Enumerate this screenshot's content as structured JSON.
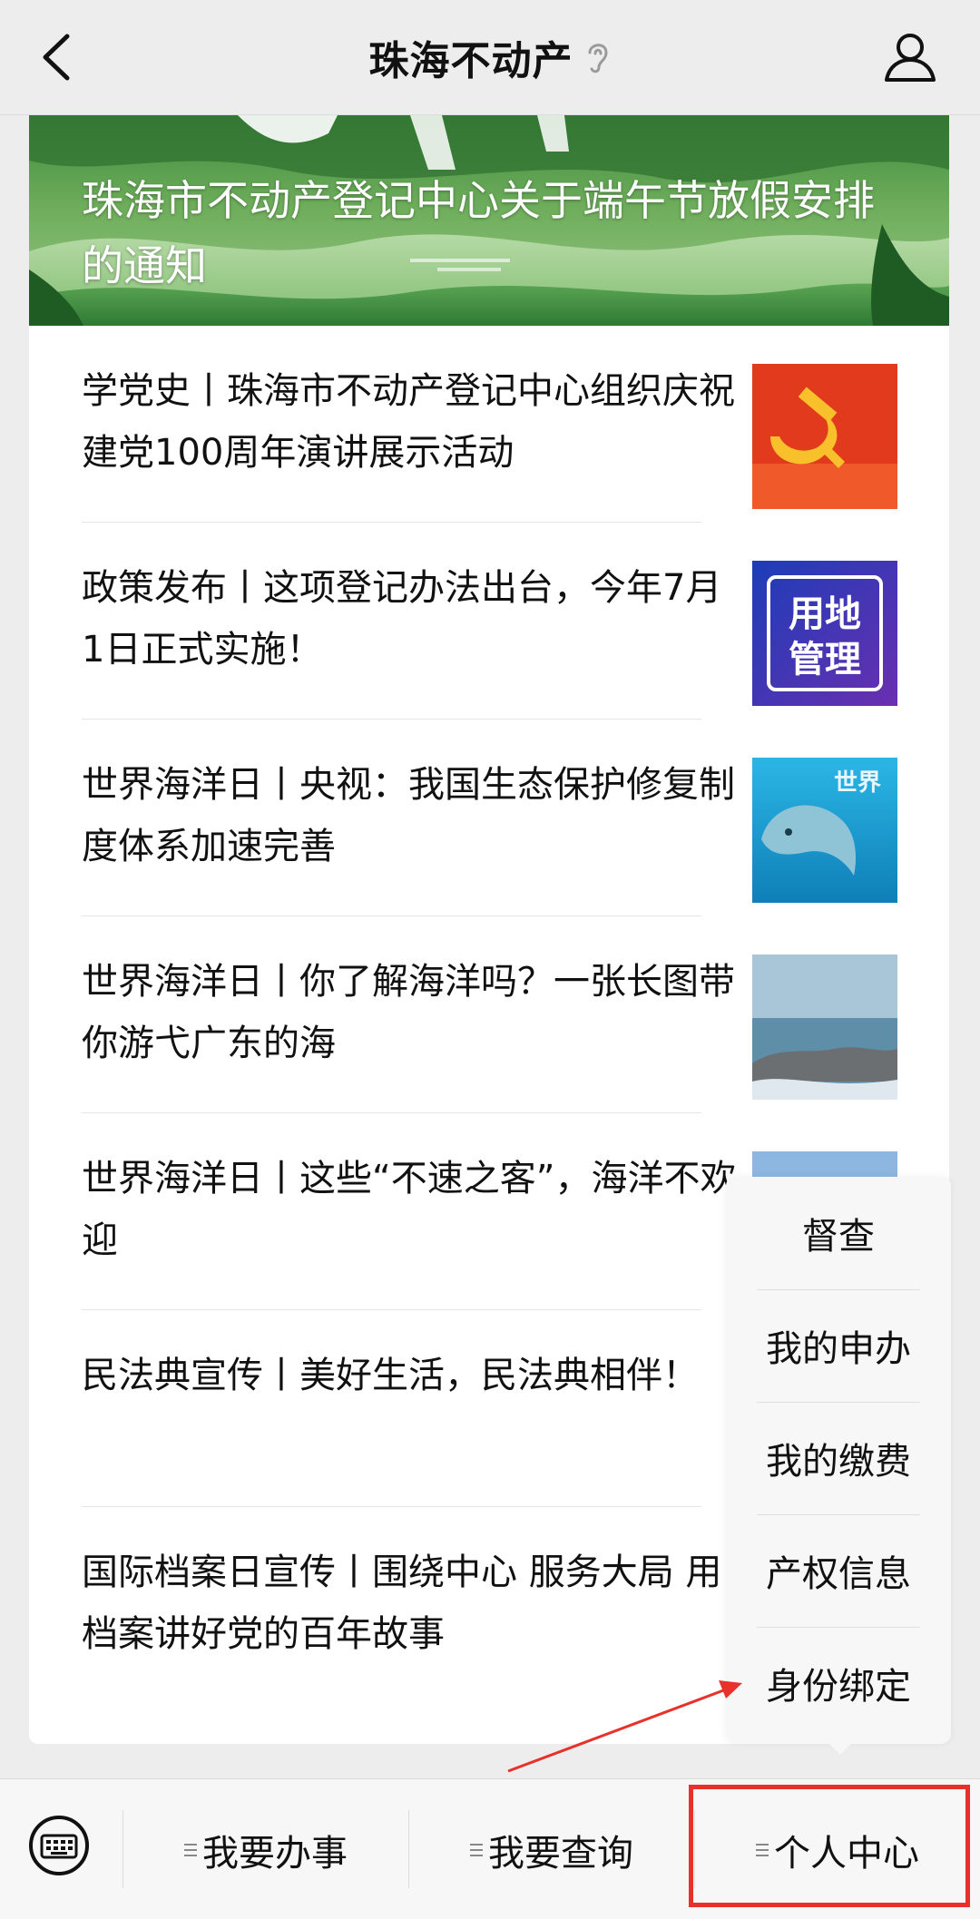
{
  "header": {
    "title": "珠海不动产",
    "back_icon": "back-arrow-icon",
    "ear_icon": "ear-icon",
    "profile_icon": "user-profile-icon"
  },
  "banner": {
    "title": "珠海市不动产登记中心关于端午节放假安排的通知"
  },
  "articles": [
    {
      "title": "学党史丨珠海市不动产登记中心组织庆祝建党100周年演讲展示活动",
      "thumb": "party-emblem-thumb"
    },
    {
      "title": "政策发布丨这项登记办法出台，今年7月1日正式实施！",
      "thumb": "land-management-thumb",
      "thumb_text_1": "用地",
      "thumb_text_2": "管理"
    },
    {
      "title": "世界海洋日丨央视：我国生态保护修复制度体系加速完善",
      "thumb": "dolphin-thumb",
      "thumb_text": "世界"
    },
    {
      "title": "世界海洋日丨你了解海洋吗？一张长图带你游弋广东的海",
      "thumb": "coast-thumb"
    },
    {
      "title": "世界海洋日丨这些“不速之客”，海洋不欢迎",
      "thumb": "ocean-thumb"
    },
    {
      "title": "民法典宣传丨美好生活，民法典相伴！"
    },
    {
      "title": "国际档案日宣传丨围绕中心  服务大局  用档案讲好党的百年故事"
    }
  ],
  "popup_menu": {
    "items": [
      "督查",
      "我的申办",
      "我的缴费",
      "产权信息",
      "身份绑定"
    ]
  },
  "bottom_menu": {
    "keyboard_icon": "keyboard-icon",
    "items": [
      "我要办事",
      "我要查询",
      "个人中心"
    ]
  },
  "colors": {
    "background": "#ededed",
    "annotation_red": "#e8312a",
    "banner_green": "#4f9a48"
  }
}
